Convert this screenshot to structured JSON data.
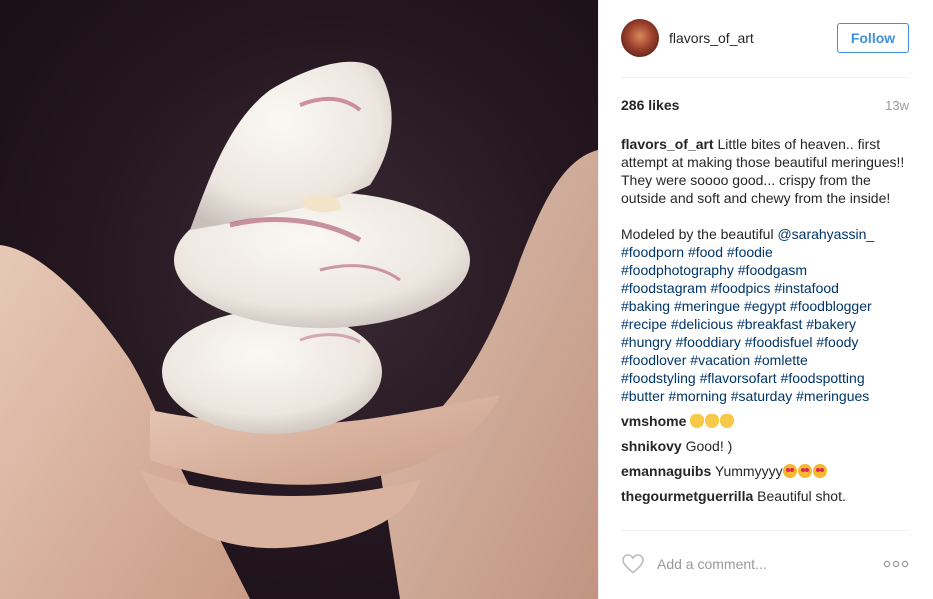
{
  "header": {
    "username": "flavors_of_art",
    "follow_label": "Follow"
  },
  "stats": {
    "likes": "286 likes",
    "age": "13w"
  },
  "caption": {
    "username": "flavors_of_art",
    "text": "Little bites of heaven.. first attempt at making those beautiful meringues!! They were soooo good... crispy from the outside and soft and chewy from the inside!",
    "modeled_by_prefix": "Modeled by the beautiful",
    "mention": "@sarahyassin_",
    "hashtag_lines": [
      [
        "#foodporn",
        "#food",
        "#foodie"
      ],
      [
        "#foodphotography",
        "#foodgasm"
      ],
      [
        "#foodstagram",
        "#foodpics",
        "#instafood"
      ],
      [
        "#baking",
        "#meringue",
        "#egypt",
        "#foodblogger"
      ],
      [
        "#recipe",
        "#delicious",
        "#breakfast",
        "#bakery"
      ],
      [
        "#hungry",
        "#fooddiary",
        "#foodisfuel",
        "#foody"
      ],
      [
        "#foodlover",
        "#vacation",
        "#omlette"
      ],
      [
        "#foodstyling",
        "#flavorsofart",
        "#foodspotting"
      ],
      [
        "#butter",
        "#morning",
        "#saturday",
        "#meringues"
      ]
    ]
  },
  "comments": [
    {
      "user": "vmshome",
      "text": "",
      "emoji": "clapping-hands",
      "emoji_count": 3
    },
    {
      "user": "shnikovy",
      "text": "Good! )",
      "emoji": "",
      "emoji_count": 0
    },
    {
      "user": "emannaguibs",
      "text": "Yummyyyy",
      "emoji": "heart-eyes",
      "emoji_count": 3
    },
    {
      "user": "thegourmetguerrilla",
      "text": "Beautiful shot.",
      "emoji": "",
      "emoji_count": 0
    }
  ],
  "comment_box": {
    "placeholder": "Add a comment..."
  },
  "icons": {
    "like": "heart-outline-icon",
    "more": "ellipsis-icon"
  },
  "colors": {
    "accent": "#4090db",
    "hashtag": "#003569",
    "muted": "#999999",
    "text": "#262626"
  }
}
